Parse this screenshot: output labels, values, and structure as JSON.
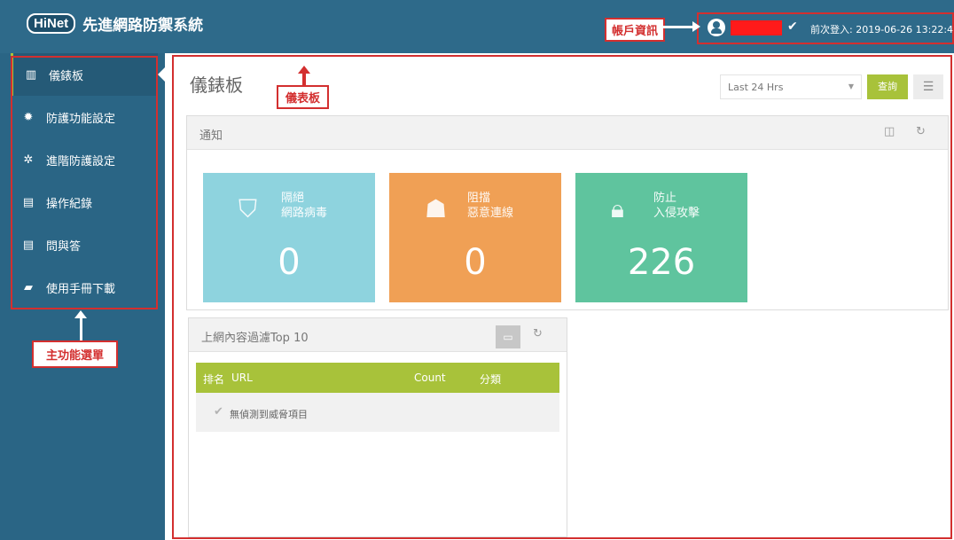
{
  "header": {
    "logo_text": "HiNet",
    "app_title": "先進網路防禦系統",
    "last_login": "前次登入: 2019-06-26 13:22:4"
  },
  "annotations": {
    "account_info": "帳戶資訊",
    "dashboard": "儀表板",
    "main_menu": "主功能選單"
  },
  "sidebar": {
    "items": [
      {
        "label": "儀錶板",
        "icon": "bar-chart-icon"
      },
      {
        "label": "防護功能設定",
        "icon": "gear-icon"
      },
      {
        "label": "進階防護設定",
        "icon": "gears-icon"
      },
      {
        "label": "操作紀錄",
        "icon": "file-icon"
      },
      {
        "label": "問與答",
        "icon": "file-icon"
      },
      {
        "label": "使用手冊下載",
        "icon": "book-icon"
      }
    ]
  },
  "main": {
    "title": "儀錶板",
    "range_select": "Last 24 Hrs",
    "query_button": "查詢",
    "notify_panel": {
      "title": "通知",
      "tiles": [
        {
          "label_line1": "隔絕",
          "label_line2": "網路病毒",
          "value": "0",
          "color": "#8ed3de",
          "icon": "shield-icon"
        },
        {
          "label_line1": "阻擋",
          "label_line2": "惡意連線",
          "value": "0",
          "color": "#f0a055",
          "icon": "spy-icon"
        },
        {
          "label_line1": "防止",
          "label_line2": "入侵攻擊",
          "value": "226",
          "color": "#5fc49e",
          "icon": "lock-icon"
        }
      ]
    },
    "filter_panel": {
      "title": "上網內容過濾Top 10",
      "columns": [
        "排名",
        "URL",
        "Count",
        "分類"
      ],
      "empty_text": "無偵測到威脅項目"
    }
  },
  "colors": {
    "topbar": "#2e6a8a",
    "sidebar": "#2a6585",
    "accent_green": "#a8c23a",
    "annotation_red": "#d32f2f"
  }
}
